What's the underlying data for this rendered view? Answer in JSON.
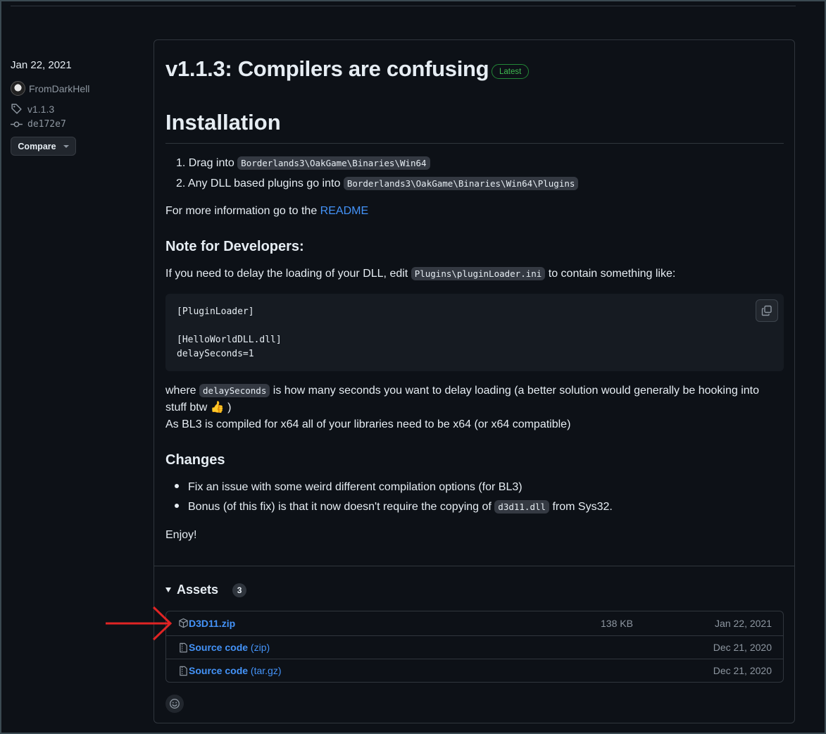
{
  "sidebar": {
    "date": "Jan 22, 2021",
    "author": "FromDarkHell",
    "tag": "v1.1.3",
    "commit": "de172e7",
    "compare_label": "Compare"
  },
  "release": {
    "title": "v1.1.3: Compilers are confusing",
    "badge": "Latest",
    "installation_heading": "Installation",
    "steps": [
      {
        "num": "1.",
        "text": "Drag into",
        "code": "Borderlands3\\OakGame\\Binaries\\Win64"
      },
      {
        "num": "2.",
        "text": "Any DLL based plugins go into",
        "code": "Borderlands3\\OakGame\\Binaries\\Win64\\Plugins"
      }
    ],
    "more_info_prefix": "For more information go to the",
    "readme_link": "README",
    "dev_heading": "Note for Developers:",
    "dev_text_prefix": "If you need to delay the loading of your DLL, edit",
    "dev_text_code": "Plugins\\pluginLoader.ini",
    "dev_text_suffix": "to contain something like:",
    "code_block": "[PluginLoader]\n\n[HelloWorldDLL.dll]\ndelaySeconds=1",
    "where_prefix": "where",
    "where_code": "delaySeconds",
    "where_line1": "is how many seconds you want to delay loading (a better solution would generally be hooking into",
    "where_line2": "stuff btw 👍 )",
    "bl3_line": "As BL3 is compiled for x64 all of your libraries need to be x64 (or x64 compatible)",
    "changes_heading": "Changes",
    "changes": [
      {
        "text": "Fix an issue with some weird different compilation options (for BL3)"
      },
      {
        "text": "Bonus (of this fix) is that it now doesn't require the copying of",
        "code": "d3d11.dll",
        "suffix": "from Sys32."
      }
    ],
    "enjoy": "Enjoy!"
  },
  "assets": {
    "heading": "Assets",
    "count": "3",
    "items": [
      {
        "name": "D3D11.zip",
        "name_suffix": "",
        "size": "138 KB",
        "date": "Jan 22, 2021",
        "icon": "package-icon"
      },
      {
        "name": "Source code",
        "name_suffix": "(zip)",
        "size": "",
        "date": "Dec 21, 2020",
        "icon": "file-zip-icon"
      },
      {
        "name": "Source code",
        "name_suffix": "(tar.gz)",
        "size": "",
        "date": "Dec 21, 2020",
        "icon": "file-zip-icon"
      }
    ]
  },
  "colors": {
    "background": "#0d1117",
    "link": "#4493f8",
    "badge_green": "#3fb950",
    "annotation_arrow": "#e02424"
  }
}
